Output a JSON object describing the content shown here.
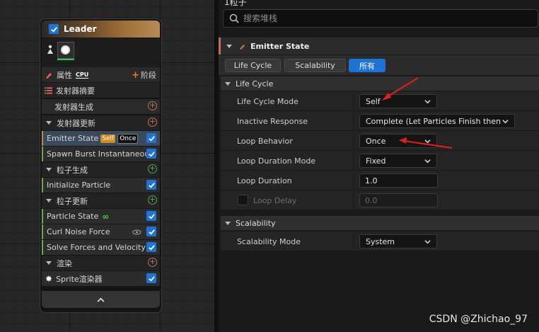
{
  "node": {
    "title": "Leader",
    "properties_label": "属性",
    "cpu_badge": "CPU",
    "stage_label": "阶段",
    "rows": {
      "summary": "发射器摘要",
      "spawn": "发射器生成",
      "update": "发射器更新",
      "emitter_state": "Emitter State",
      "badge_self": "Self",
      "badge_once": "Once",
      "spawn_burst": "Spawn Burst Instantaneous",
      "particle_spawn": "粒子生成",
      "initialize_particle": "Initialize Particle",
      "particle_update": "粒子更新",
      "particle_state": "Particle State",
      "curl_noise": "Curl Noise Force",
      "solve_forces": "Solve Forces and Velocity",
      "render": "渲染",
      "sprite_renderer": "Sprite渲染器"
    }
  },
  "panel": {
    "title": "1粒子",
    "search_placeholder": "搜索堆栈",
    "emitter_state_title": "Emitter State",
    "filters": [
      "Life Cycle",
      "Scalability",
      "所有"
    ],
    "categories": {
      "life_cycle": "Life Cycle",
      "scalability": "Scalability"
    },
    "props": {
      "life_cycle_mode": {
        "name": "Life Cycle Mode",
        "value": "Self"
      },
      "inactive_response": {
        "name": "Inactive Response",
        "value": "Complete (Let Particles Finish then"
      },
      "loop_behavior": {
        "name": "Loop Behavior",
        "value": "Once"
      },
      "loop_duration_mode": {
        "name": "Loop Duration Mode",
        "value": "Fixed"
      },
      "loop_duration": {
        "name": "Loop Duration",
        "value": "1.0"
      },
      "loop_delay": {
        "name": "Loop Delay",
        "value": "0.0"
      },
      "scalability_mode": {
        "name": "Scalability Mode",
        "value": "System"
      }
    }
  },
  "watermark": "CSDN @Zhichao_97",
  "colors": {
    "accent_blue": "#1e73d6",
    "annotation_red": "#e0201a",
    "self_badge": "#d4891e",
    "stage_plus": "#ff7a1a"
  }
}
